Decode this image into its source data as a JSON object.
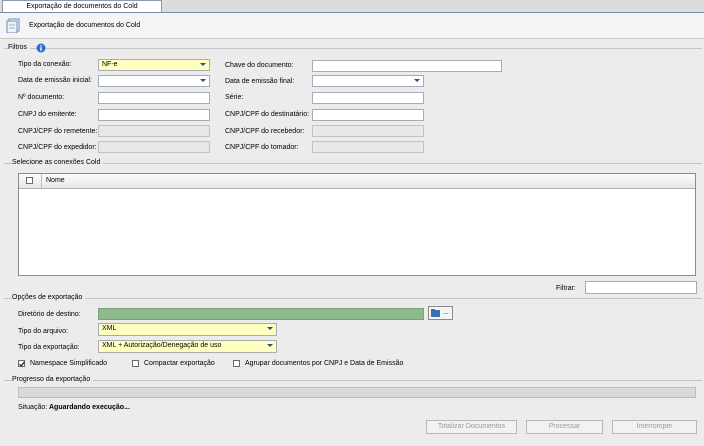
{
  "tab": {
    "title": "Exportação de documentos do Cold"
  },
  "header": {
    "title": "Exportação de documentos do Cold",
    "icon": "document-icon"
  },
  "filtros": {
    "title": "Filtros",
    "info_icon": "info-icon",
    "tipo_conexao": {
      "label": "Tipo da conexão:",
      "value": "NF-e"
    },
    "data_emissao_inicial": {
      "label": "Data de emissão inicial:",
      "value": ""
    },
    "numero_documento": {
      "label": "Nº documento:",
      "value": ""
    },
    "cnpj_emitente": {
      "label": "CNPJ do emitente:",
      "value": ""
    },
    "cnpj_remetente": {
      "label": "CNPJ/CPF do remetente:",
      "value": ""
    },
    "cnpj_expedidor": {
      "label": "CNPJ/CPF do expedidor:",
      "value": ""
    },
    "chave_documento": {
      "label": "Chave do documento:",
      "value": ""
    },
    "data_emissao_final": {
      "label": "Data de emissão final:",
      "value": ""
    },
    "serie": {
      "label": "Série:",
      "value": ""
    },
    "cnpj_destinatario": {
      "label": "CNPJ/CPF do destinatário:",
      "value": ""
    },
    "cnpj_recebedor": {
      "label": "CNPJ/CPF do recebedor:",
      "value": ""
    },
    "cnpj_tomador": {
      "label": "CNPJ/CPF do tomador:",
      "value": ""
    }
  },
  "conexoes": {
    "title": "Selecione as conexões Cold",
    "column_nome": "Nome",
    "filter_label": "Filtrar:",
    "filter_value": ""
  },
  "opcoes": {
    "title": "Opções de exportação",
    "diretorio": {
      "label": "Diretório de destino:",
      "value": ""
    },
    "browse_label": "...",
    "tipo_arquivo": {
      "label": "Tipo do arquivo:",
      "value": "XML"
    },
    "tipo_exportacao": {
      "label": "Tipo da exportação:",
      "value": "XML + Autorização/Denegação de uso"
    },
    "namespace": {
      "label": "Namespace Simplificado",
      "checked": true
    },
    "compactar": {
      "label": "Compactar exportação",
      "checked": false
    },
    "agrupar": {
      "label": "Agrupar documentos por CNPJ e Data de Emissão",
      "checked": false
    }
  },
  "progresso": {
    "title": "Progresso da exportação",
    "progress": 0,
    "situacao_label": "Situação:",
    "situacao_value": "Aguardando execução..."
  },
  "buttons": {
    "totalizar": "Totalizar Documentos",
    "processar": "Processar",
    "interromper": "Interromper"
  },
  "colors": {
    "yellow_input": "#ffffc0",
    "green_input": "#8dbb8c"
  }
}
